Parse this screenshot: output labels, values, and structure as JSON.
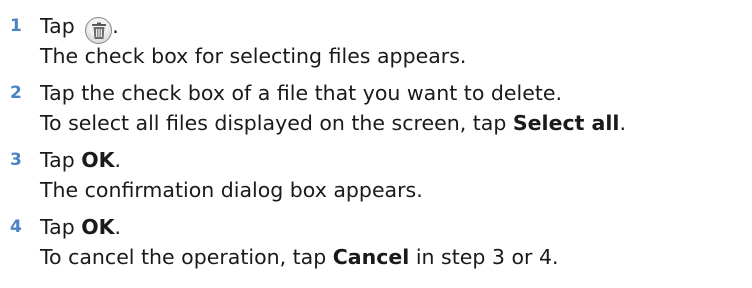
{
  "steps": [
    {
      "number": "1",
      "line1": {
        "before": "Tap ",
        "after": "."
      },
      "line2": "The check box for selecting files appears."
    },
    {
      "number": "2",
      "line1": "Tap the check box of a file that you want to delete.",
      "line2": {
        "before": "To select all files displayed on the screen, tap ",
        "bold": "Select all",
        "after": "."
      }
    },
    {
      "number": "3",
      "line1": {
        "before": "Tap ",
        "bold": "OK",
        "after": "."
      },
      "line2": "The confirmation dialog box appears."
    },
    {
      "number": "4",
      "line1": {
        "before": "Tap ",
        "bold": "OK",
        "after": "."
      },
      "line2": {
        "before": "To cancel the operation, tap ",
        "bold": "Cancel",
        "after": " in step 3 or 4."
      }
    }
  ],
  "icons": {
    "step1_icon": "trash-icon"
  },
  "colors": {
    "step_number": "#4a82c3",
    "text": "#1a1a1a"
  }
}
